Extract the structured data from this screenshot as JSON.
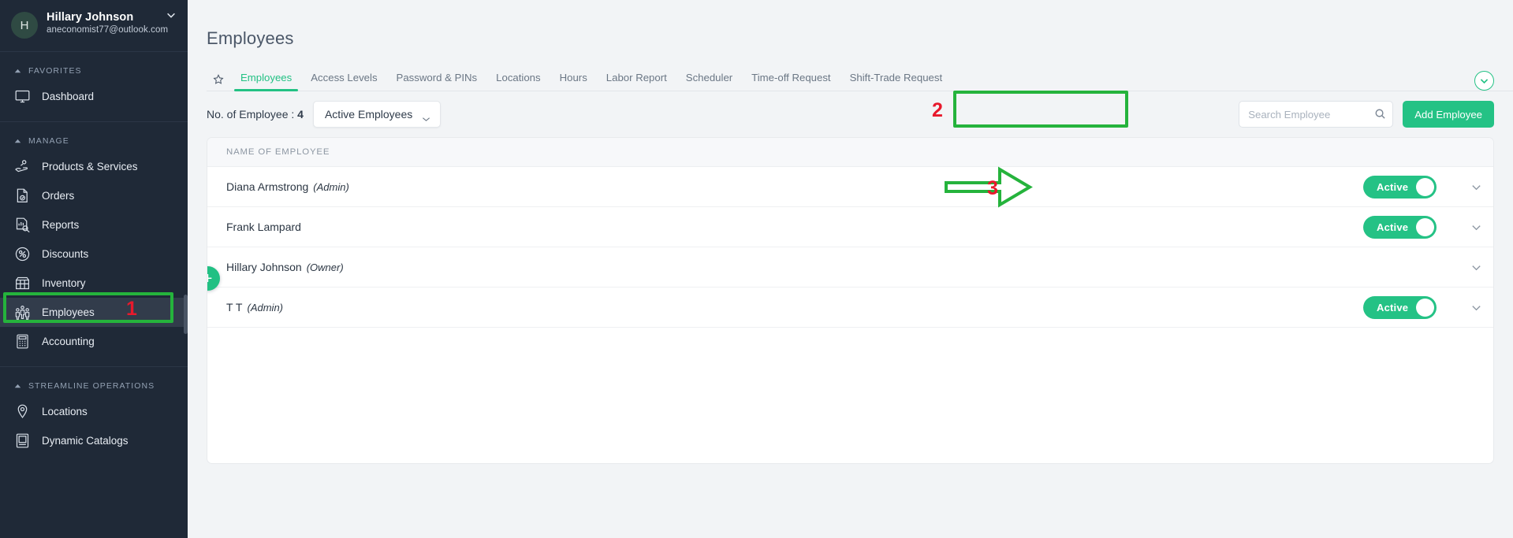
{
  "sidebar": {
    "user": {
      "initial": "H",
      "name": "Hillary Johnson",
      "email": "aneconomist77@outlook.com"
    },
    "sections": [
      {
        "label": "FAVORITES",
        "items": [
          {
            "label": "Dashboard",
            "icon": "monitor-icon",
            "active": false
          }
        ]
      },
      {
        "label": "MANAGE",
        "items": [
          {
            "label": "Products & Services",
            "icon": "products-icon",
            "active": false
          },
          {
            "label": "Orders",
            "icon": "orders-icon",
            "active": false
          },
          {
            "label": "Reports",
            "icon": "reports-icon",
            "active": false
          },
          {
            "label": "Discounts",
            "icon": "discount-percent-icon",
            "active": false
          },
          {
            "label": "Inventory",
            "icon": "inventory-box-icon",
            "active": false
          },
          {
            "label": "Employees",
            "icon": "employees-people-icon",
            "active": true
          },
          {
            "label": "Accounting",
            "icon": "calculator-icon",
            "active": false
          }
        ]
      },
      {
        "label": "STREAMLINE OPERATIONS",
        "items": [
          {
            "label": "Locations",
            "icon": "location-pin-icon",
            "active": false
          },
          {
            "label": "Dynamic Catalogs",
            "icon": "catalog-icon",
            "active": false
          }
        ]
      }
    ]
  },
  "main": {
    "page_title": "Employees",
    "tabs": [
      {
        "label": "Employees",
        "active": true
      },
      {
        "label": "Access Levels",
        "active": false
      },
      {
        "label": "Password & PINs",
        "active": false
      },
      {
        "label": "Locations",
        "active": false
      },
      {
        "label": "Hours",
        "active": false
      },
      {
        "label": "Labor Report",
        "active": false
      },
      {
        "label": "Scheduler",
        "active": false
      },
      {
        "label": "Time-off Request",
        "active": false
      },
      {
        "label": "Shift-Trade Request",
        "active": false
      }
    ],
    "toolbar": {
      "count_label": "No. of Employee : ",
      "count_value": "4",
      "filter_selected": "Active Employees",
      "search_placeholder": "Search Employee",
      "search_value": "",
      "add_button": "Add Employee"
    },
    "table": {
      "header": "NAME OF EMPLOYEE",
      "rows": [
        {
          "name": "Diana Armstrong",
          "role": "(Admin)",
          "status": "Active",
          "has_toggle": true
        },
        {
          "name": "Frank Lampard",
          "role": "",
          "status": "Active",
          "has_toggle": true
        },
        {
          "name": "Hillary Johnson",
          "role": "(Owner)",
          "status": "",
          "has_toggle": false
        },
        {
          "name": "T T",
          "role": "(Admin)",
          "status": "Active",
          "has_toggle": true
        }
      ]
    }
  },
  "annotations": {
    "step1": "1",
    "step2": "2",
    "step3": "3"
  },
  "colors": {
    "accent_green": "#24c285",
    "sidebar_bg": "#1f2937",
    "annotation_green": "#25b33c",
    "annotation_red": "#e8192c"
  }
}
